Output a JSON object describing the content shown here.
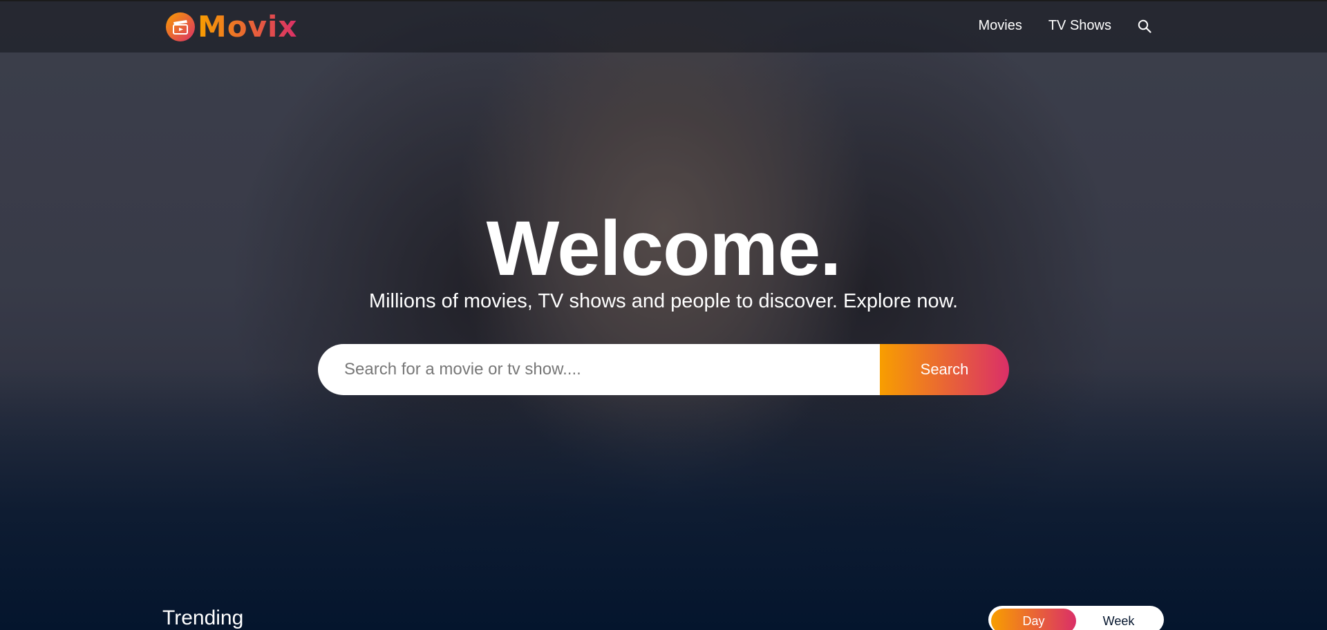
{
  "header": {
    "logo_text": "Movix",
    "nav": [
      {
        "label": "Movies"
      },
      {
        "label": "TV Shows"
      }
    ],
    "search_icon": "search-icon"
  },
  "hero": {
    "title": "Welcome.",
    "subtitle": "Millions of movies, TV shows and people to discover. Explore now.",
    "search": {
      "placeholder": "Search for a movie or tv show....",
      "value": "",
      "button_label": "Search"
    }
  },
  "trending": {
    "title": "Trending",
    "tabs": [
      {
        "label": "Day",
        "active": true
      },
      {
        "label": "Week",
        "active": false
      }
    ]
  },
  "colors": {
    "background": "#04152d",
    "accent_start": "#f89e00",
    "accent_end": "#da2f68"
  }
}
